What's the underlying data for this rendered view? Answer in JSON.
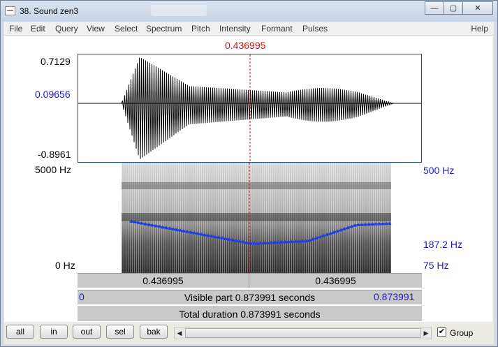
{
  "window": {
    "title": "38. Sound zen3",
    "minimize_glyph": "—",
    "maximize_glyph": "▢",
    "close_glyph": "✕"
  },
  "menu": [
    "File",
    "Edit",
    "Query",
    "View",
    "Select",
    "Spectrum",
    "Pitch",
    "Intensity",
    "Formant",
    "Pulses"
  ],
  "menu_help": "Help",
  "cursor_time": "0.436995",
  "waveform": {
    "max_label": "0.7129",
    "cursor_value_label": "0.09656",
    "min_label": "-0.8961"
  },
  "spectrogram": {
    "freq_top_label": "5000 Hz",
    "freq_bottom_label": "0 Hz",
    "pitch_top_label": "500 Hz",
    "pitch_value_label": "187.2 Hz",
    "pitch_bottom_label": "75 Hz"
  },
  "time_bar": {
    "left_segment": "0.436995",
    "right_segment": "0.436995"
  },
  "visible_bar": {
    "start": "0",
    "text": "Visible part 0.873991 seconds",
    "end": "0.873991"
  },
  "total_bar": {
    "text": "Total duration 0.873991 seconds"
  },
  "buttons": {
    "all": "all",
    "in": "in",
    "out": "out",
    "sel": "sel",
    "bak": "bak"
  },
  "scroll": {
    "left_arrow": "◀",
    "right_arrow": "▶"
  },
  "group": {
    "label": "Group",
    "checked": true,
    "check_glyph": "✔"
  },
  "colors": {
    "cursor": "#cc1111",
    "axis_blue": "#1a1acc",
    "pitch_curve": "#1f3fe0"
  }
}
